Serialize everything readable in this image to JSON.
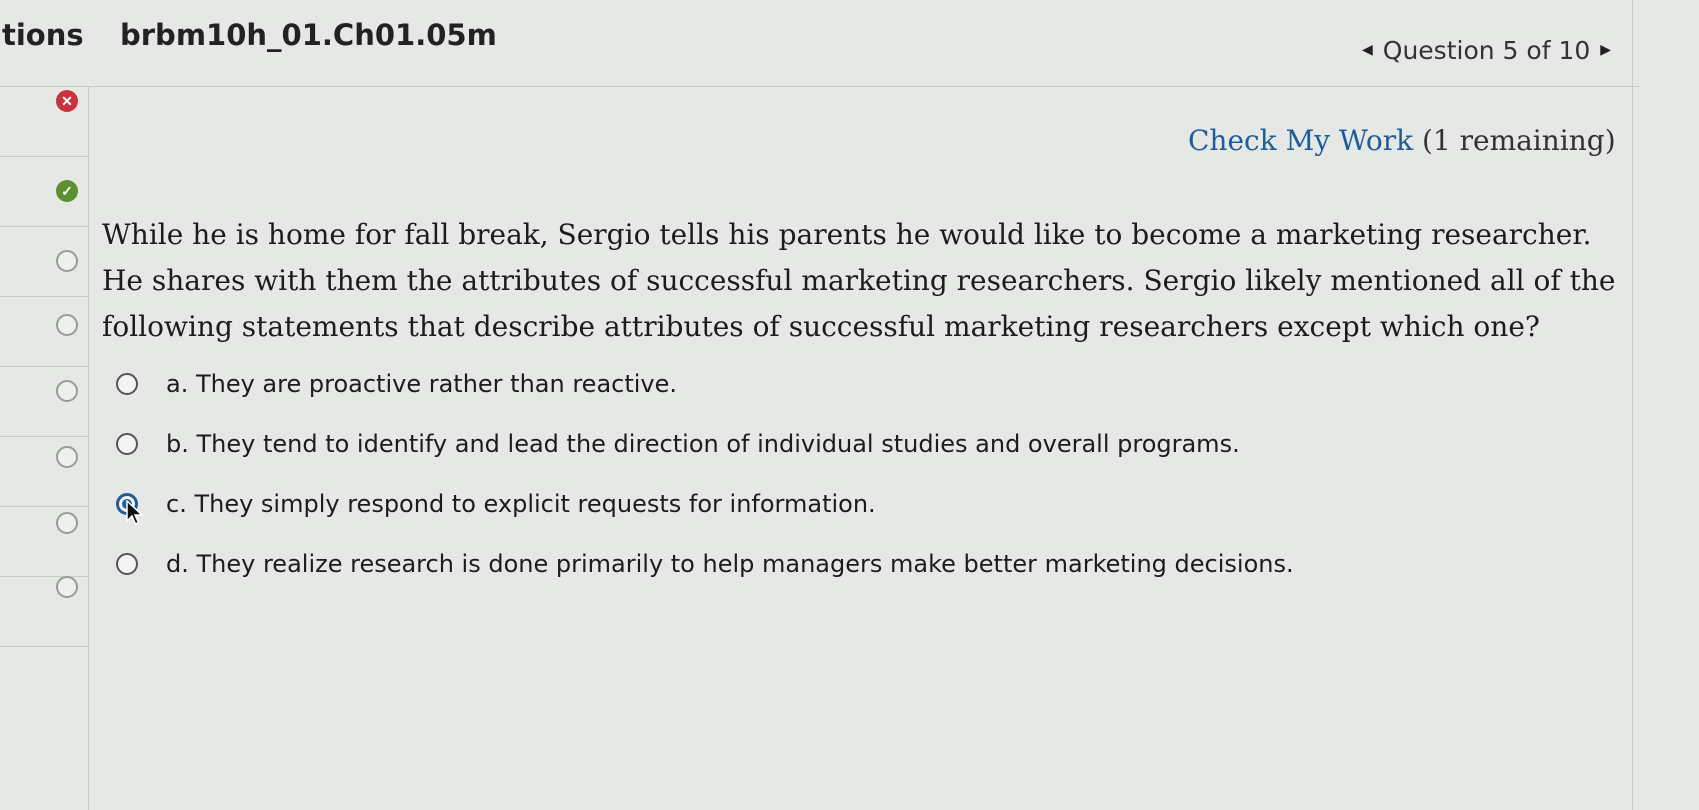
{
  "header": {
    "left_label": "tions",
    "assignment_title": "brbm10h_01.Ch01.05m",
    "question_nav": "Question 5 of 10",
    "prev_icon": "triangle-left-icon",
    "next_icon": "triangle-right-icon"
  },
  "rail": {
    "statuses": [
      "wrong",
      "correct",
      "unanswered",
      "unanswered",
      "unanswered",
      "unanswered",
      "unanswered",
      "unanswered"
    ],
    "colors": {
      "wrong": "#c8333f",
      "correct": "#5c8f2f",
      "unanswered": "#9a9c9a"
    }
  },
  "check_my_work": {
    "label": "Check My Work",
    "remaining": "(1 remaining)"
  },
  "question": {
    "stem": "While he is home for fall break, Sergio tells his parents he would like to become a marketing researcher. He shares with them the attributes of successful marketing researchers. Sergio likely mentioned all of the following statements that describe attributes of successful marketing researchers except which one?",
    "options": [
      {
        "label": "a. They are proactive rather than reactive.",
        "selected": false
      },
      {
        "label": "b. They tend to identify and lead the direction of individual studies and overall programs.",
        "selected": false
      },
      {
        "label": "c. They simply respond to explicit requests for information.",
        "selected": true
      },
      {
        "label": "d. They realize research is done primarily to help managers make better marketing decisions.",
        "selected": false
      }
    ]
  },
  "accent_color": "#1f5d98"
}
